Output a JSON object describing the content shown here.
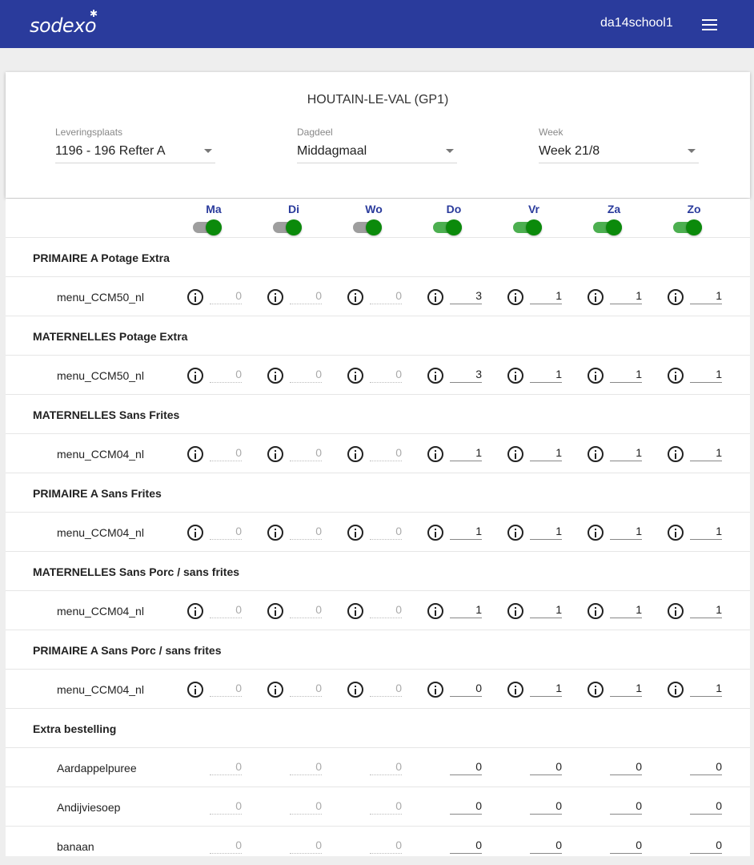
{
  "header": {
    "logo": "sodexo",
    "user": "da14school1"
  },
  "filters": {
    "school": "HOUTAIN-LE-VAL (GP1)",
    "location": {
      "label": "Leveringsplaats",
      "value": "1196 - 196 Refter A"
    },
    "daypart": {
      "label": "Dagdeel",
      "value": "Middagmaal"
    },
    "week": {
      "label": "Week",
      "value": "Week 21/8"
    }
  },
  "days": [
    {
      "label": "Ma",
      "enabled": true
    },
    {
      "label": "Di",
      "enabled": true
    },
    {
      "label": "Wo",
      "enabled": true
    },
    {
      "label": "Do",
      "enabled": true
    },
    {
      "label": "Vr",
      "enabled": true
    },
    {
      "label": "Za",
      "enabled": true
    },
    {
      "label": "Zo",
      "enabled": true
    }
  ],
  "colors": {
    "brand": "#2a3b9c",
    "toggle_knob": "#0b8a0b",
    "toggle_track_disabled": "#9e9e9e",
    "toggle_track_enabled": "#4caf50"
  },
  "sections": [
    {
      "title": "PRIMAIRE A Potage Extra",
      "items": [
        {
          "name": "menu_CCM50_nl",
          "info": true,
          "values": [
            "0",
            "0",
            "0",
            "3",
            "1",
            "1",
            "1"
          ]
        }
      ]
    },
    {
      "title": "MATERNELLES Potage Extra",
      "items": [
        {
          "name": "menu_CCM50_nl",
          "info": true,
          "values": [
            "0",
            "0",
            "0",
            "3",
            "1",
            "1",
            "1"
          ]
        }
      ]
    },
    {
      "title": "MATERNELLES Sans Frites",
      "items": [
        {
          "name": "menu_CCM04_nl",
          "info": true,
          "values": [
            "0",
            "0",
            "0",
            "1",
            "1",
            "1",
            "1"
          ]
        }
      ]
    },
    {
      "title": "PRIMAIRE A Sans Frites",
      "items": [
        {
          "name": "menu_CCM04_nl",
          "info": true,
          "values": [
            "0",
            "0",
            "0",
            "1",
            "1",
            "1",
            "1"
          ]
        }
      ]
    },
    {
      "title": "MATERNELLES Sans Porc / sans frites",
      "items": [
        {
          "name": "menu_CCM04_nl",
          "info": true,
          "values": [
            "0",
            "0",
            "0",
            "1",
            "1",
            "1",
            "1"
          ]
        }
      ]
    },
    {
      "title": "PRIMAIRE A Sans Porc / sans frites",
      "items": [
        {
          "name": "menu_CCM04_nl",
          "info": true,
          "values": [
            "0",
            "0",
            "0",
            "0",
            "1",
            "1",
            "1"
          ]
        }
      ]
    },
    {
      "title": "Extra bestelling",
      "items": [
        {
          "name": "Aardappelpuree",
          "info": false,
          "values": [
            "0",
            "0",
            "0",
            "0",
            "0",
            "0",
            "0"
          ]
        },
        {
          "name": "Andijviesoep",
          "info": false,
          "values": [
            "0",
            "0",
            "0",
            "0",
            "0",
            "0",
            "0"
          ]
        },
        {
          "name": "banaan",
          "info": false,
          "values": [
            "0",
            "0",
            "0",
            "0",
            "0",
            "0",
            "0"
          ]
        }
      ]
    }
  ],
  "disabled_days": [
    0,
    1,
    2
  ]
}
